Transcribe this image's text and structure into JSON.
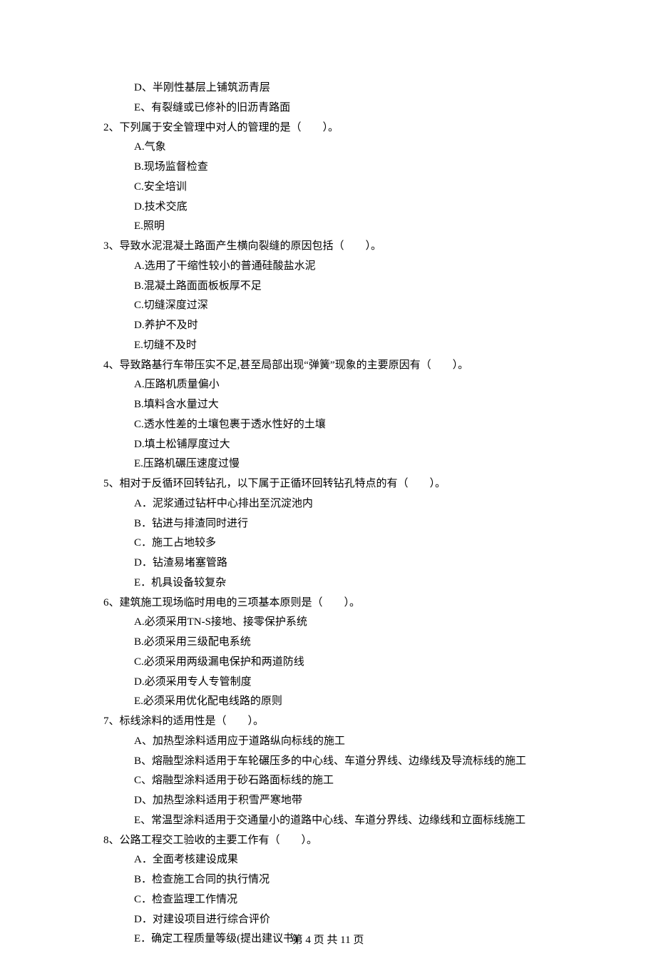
{
  "footer": "第 4 页 共 11 页",
  "continued_options": [
    "D、半刚性基层上铺筑沥青层",
    "E、有裂缝或已修补的旧沥青路面"
  ],
  "questions": [
    {
      "stem": "2、下列属于安全管理中对人的管理的是（　　）。",
      "options": [
        "A.气象",
        "B.现场监督检查",
        "C.安全培训",
        "D.技术交底",
        "E.照明"
      ]
    },
    {
      "stem": "3、导致水泥混凝土路面产生横向裂缝的原因包括（　　）。",
      "options": [
        "A.选用了干缩性较小的普通硅酸盐水泥",
        "B.混凝土路面面板板厚不足",
        "C.切缝深度过深",
        "D.养护不及时",
        "E.切缝不及时"
      ]
    },
    {
      "stem": "4、导致路基行车带压实不足,甚至局部出现“弹簧”现象的主要原因有（　　）。",
      "options": [
        "A.压路机质量偏小",
        "B.填料含水量过大",
        "C.透水性差的土壤包裹于透水性好的土壤",
        "D.填土松铺厚度过大",
        "E.压路机碾压速度过慢"
      ]
    },
    {
      "stem": "5、相对于反循环回转钻孔，以下属于正循环回转钻孔特点的有（　　）。",
      "options": [
        "A．泥浆通过钻杆中心排出至沉淀池内",
        "B．钻进与排渣同时进行",
        "C．施工占地较多",
        "D．钻渣易堵塞管路",
        "E．机具设备较复杂"
      ]
    },
    {
      "stem": "6、建筑施工现场临时用电的三项基本原则是（　　）。",
      "options": [
        "A.必须采用TN-S接地、接零保护系统",
        "B.必须采用三级配电系统",
        "C.必须采用两级漏电保护和两道防线",
        "D.必须采用专人专管制度",
        "E.必须采用优化配电线路的原则"
      ]
    },
    {
      "stem": "7、标线涂料的适用性是（　　）。",
      "options": [
        "A、加热型涂料适用应于道路纵向标线的施工",
        "B、熔融型涂料适用于车轮碾压多的中心线、车道分界线、边缘线及导流标线的施工",
        "C、熔融型涂料适用于砂石路面标线的施工",
        "D、加热型涂料适用于积雪严寒地带",
        "E、常温型涂料适用于交通量小的道路中心线、车道分界线、边缘线和立面标线施工"
      ]
    },
    {
      "stem": "8、公路工程交工验收的主要工作有（　　）。",
      "options": [
        "A．全面考核建设成果",
        "B．检查施工合同的执行情况",
        "C．检查监理工作情况",
        "D．对建设项目进行综合评价",
        "E．确定工程质量等级(提出建议书)"
      ]
    }
  ]
}
